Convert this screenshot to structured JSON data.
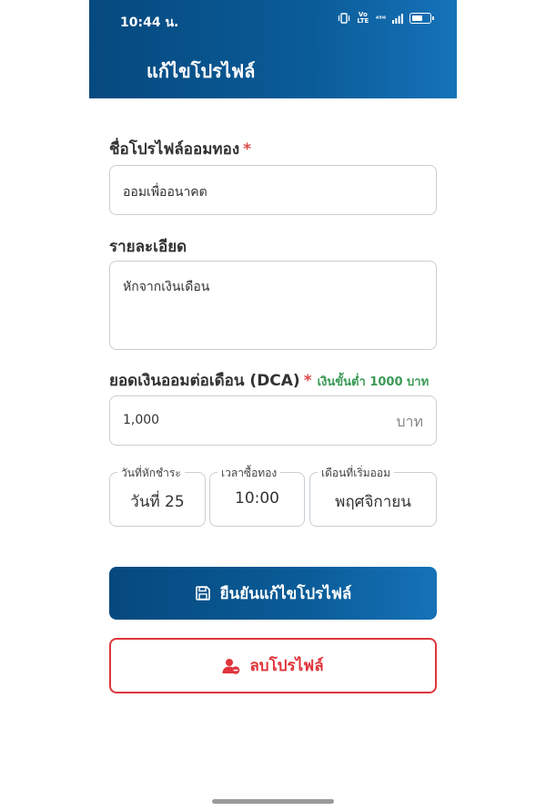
{
  "status_bar": {
    "time": "10:44 น.",
    "volte": "Vo LTE",
    "network": "⁴⁵ᴳ"
  },
  "header": {
    "title": "แก้ไขโปรไฟล์"
  },
  "form": {
    "profile_name": {
      "label": "ชื่อโปรไฟล์ออมทอง",
      "required": "*",
      "value": "ออมเพื่ออนาคต"
    },
    "description": {
      "label": "รายละเอียด",
      "value": "หักจากเงินเดือน"
    },
    "dca": {
      "label": "ยอดเงินออมต่อเดือน (DCA)",
      "required": "*",
      "hint": "เงินขั้นต่ำ 1000 บาท",
      "value": "1,000",
      "suffix": "บาท"
    },
    "payment_day": {
      "label": "วันที่หักชำระ",
      "value": "วันที่ 25"
    },
    "buy_time": {
      "label": "เวลาซื้อทอง",
      "value": "10:00"
    },
    "start_month": {
      "label": "เดือนที่เริ่มออม",
      "value": "พฤศจิกายน"
    }
  },
  "buttons": {
    "confirm": "ยืนยันแก้ไขโปรไฟล์",
    "delete": "ลบโปรไฟล์"
  },
  "colors": {
    "header": "#0a5c98",
    "required": "#e04848",
    "hint": "#3a9a55",
    "danger": "#e0353b"
  }
}
